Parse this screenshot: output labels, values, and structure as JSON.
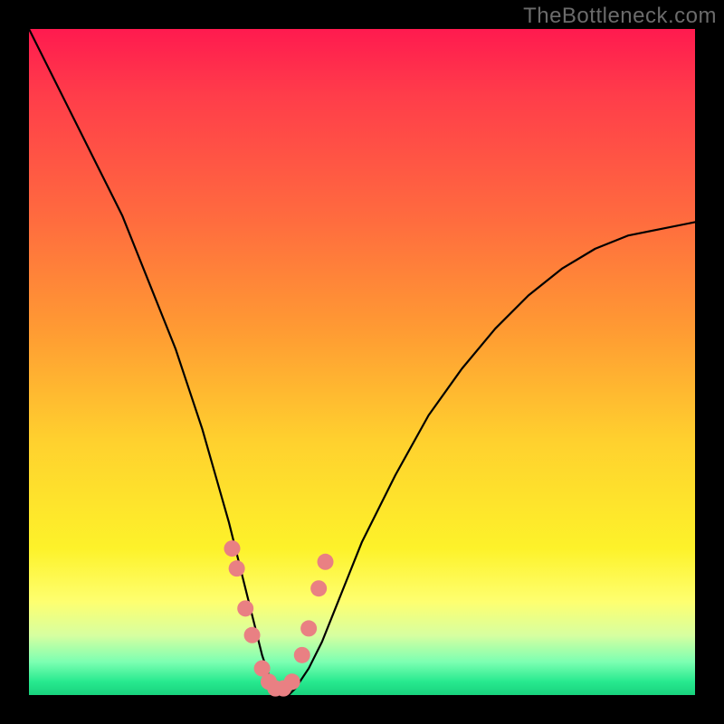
{
  "attribution": "TheBottleneck.com",
  "chart_data": {
    "type": "line",
    "title": "",
    "xlabel": "",
    "ylabel": "",
    "xlim": [
      0,
      100
    ],
    "ylim": [
      0,
      100
    ],
    "background_gradient": {
      "direction": "vertical",
      "stops": [
        {
          "pos": 0,
          "color": "#ff1a4f"
        },
        {
          "pos": 45,
          "color": "#ff9a33"
        },
        {
          "pos": 78,
          "color": "#fdf22a"
        },
        {
          "pos": 95,
          "color": "#7dffb2"
        },
        {
          "pos": 100,
          "color": "#19d27d"
        }
      ]
    },
    "series": [
      {
        "name": "bottleneck-curve",
        "color": "#000000",
        "x": [
          0,
          2,
          4,
          6,
          8,
          10,
          12,
          14,
          16,
          18,
          20,
          22,
          24,
          26,
          28,
          30,
          32,
          33,
          34,
          35,
          36,
          37,
          38,
          39,
          40,
          42,
          44,
          46,
          48,
          50,
          55,
          60,
          65,
          70,
          75,
          80,
          85,
          90,
          95,
          100
        ],
        "y": [
          100,
          96,
          92,
          88,
          84,
          80,
          76,
          72,
          67,
          62,
          57,
          52,
          46,
          40,
          33,
          26,
          18,
          14,
          10,
          6,
          3,
          1,
          0,
          0,
          1,
          4,
          8,
          13,
          18,
          23,
          33,
          42,
          49,
          55,
          60,
          64,
          67,
          69,
          70,
          71
        ]
      },
      {
        "name": "highlight-markers",
        "color": "#e98083",
        "style": "dots",
        "x": [
          30.5,
          31.2,
          32.5,
          33.5,
          35.0,
          36.0,
          37.0,
          38.2,
          39.5,
          41.0,
          42.0,
          43.5,
          44.5
        ],
        "y": [
          22,
          19,
          13,
          9,
          4,
          2,
          1,
          1,
          2,
          6,
          10,
          16,
          20
        ]
      }
    ]
  }
}
